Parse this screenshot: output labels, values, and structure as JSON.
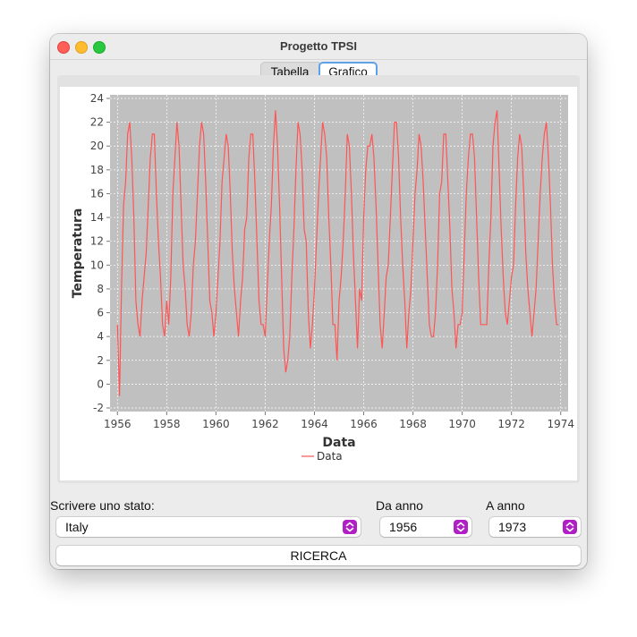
{
  "window": {
    "title": "Progetto TPSI"
  },
  "tabs": [
    {
      "label": "Tabella"
    },
    {
      "label": "Grafico"
    }
  ],
  "form": {
    "state_label": "Scrivere uno stato:",
    "state_value": "Italy",
    "from_label": "Da anno",
    "from_value": "1956",
    "to_label": "A anno",
    "to_value": "1973",
    "search_button": "RICERCA"
  },
  "colors": {
    "series": "#ff5555",
    "plot_bg": "#c0c0c0",
    "accent": "#b01fc4"
  },
  "icons": {
    "combo_arrow": "updown-chevron-icon"
  },
  "chart_data": {
    "type": "line",
    "title": "",
    "xlabel": "Data",
    "ylabel": "Temperatura",
    "xlim": [
      1955.7,
      1974.3
    ],
    "ylim": [
      -2.3,
      24.3
    ],
    "grid": true,
    "legend": "bottom-center",
    "xticks": [
      "1956",
      "1958",
      "1960",
      "1962",
      "1964",
      "1966",
      "1968",
      "1970",
      "1972",
      "1974"
    ],
    "yticks": [
      "-2",
      "0",
      "2",
      "4",
      "6",
      "8",
      "10",
      "12",
      "14",
      "16",
      "18",
      "20",
      "22",
      "24"
    ],
    "series": [
      {
        "name": "Data",
        "color": "#ff5555",
        "x_start": 1956.0,
        "x_step": 0.08333,
        "values": [
          5,
          -1,
          8,
          15,
          17,
          21,
          22,
          19,
          14,
          7,
          5,
          4,
          7,
          9,
          11,
          15,
          19,
          21,
          21,
          16,
          12,
          9,
          5,
          4,
          7,
          5,
          9,
          16,
          19,
          22,
          20,
          15,
          10,
          8,
          5,
          4,
          6,
          10,
          12,
          16,
          20,
          22,
          21,
          17,
          12,
          7,
          6,
          4,
          6,
          9,
          12,
          17,
          19,
          21,
          20,
          16,
          11,
          8,
          6,
          4,
          7,
          9,
          13,
          14,
          19,
          21,
          21,
          17,
          12,
          7,
          5,
          5,
          4,
          8,
          12,
          15,
          20,
          23,
          20,
          15,
          9,
          3,
          1,
          2,
          4,
          9,
          13,
          18,
          22,
          21,
          18,
          13,
          12,
          6,
          3,
          5,
          8,
          12,
          16,
          19,
          22,
          21,
          19,
          14,
          10,
          5,
          5,
          2,
          7,
          9,
          12,
          16,
          21,
          20,
          16,
          11,
          7,
          3,
          8,
          7,
          14,
          18,
          20,
          20,
          21,
          19,
          15,
          10,
          5,
          3,
          6,
          9,
          10,
          14,
          18,
          22,
          22,
          19,
          14,
          10,
          7,
          3,
          6,
          8,
          12,
          16,
          18,
          21,
          20,
          17,
          13,
          9,
          5,
          4,
          4,
          6,
          10,
          16,
          17,
          21,
          21,
          17,
          13,
          8,
          6,
          3,
          5,
          5,
          6,
          11,
          16,
          19,
          21,
          21,
          19,
          14,
          9,
          5,
          5,
          5,
          5,
          10,
          14,
          20,
          22,
          23,
          18,
          13,
          9,
          6,
          5,
          7,
          9,
          10,
          15,
          19,
          21,
          20,
          16,
          11,
          8,
          6,
          4,
          6,
          8,
          12,
          16,
          19,
          21,
          22,
          19,
          15,
          10,
          7,
          5,
          5
        ]
      }
    ]
  }
}
